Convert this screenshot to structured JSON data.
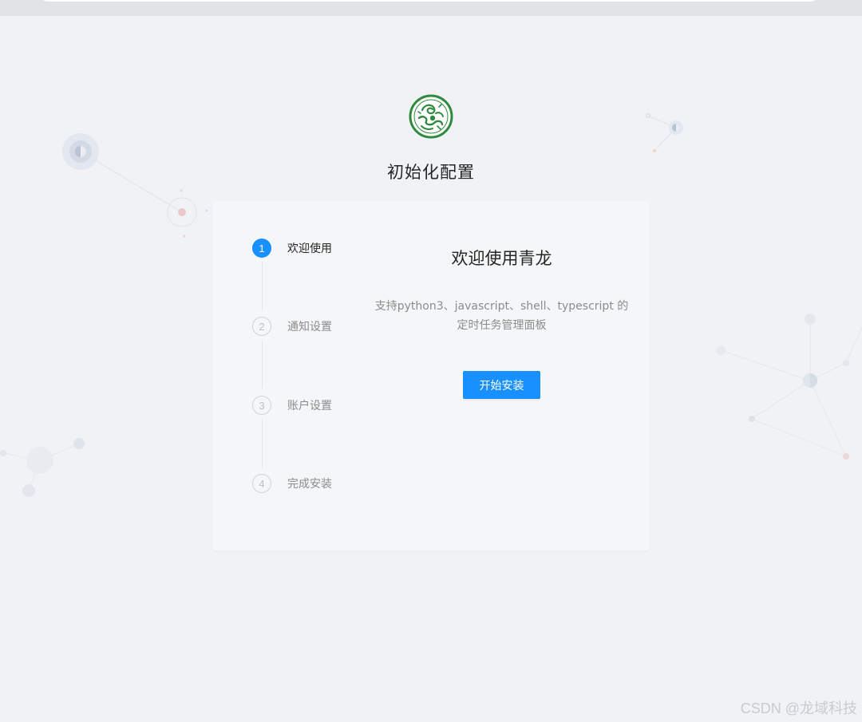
{
  "page": {
    "title": "初始化配置"
  },
  "steps": [
    {
      "number": "1",
      "label": "欢迎使用",
      "status": "active"
    },
    {
      "number": "2",
      "label": "通知设置",
      "status": "wait"
    },
    {
      "number": "3",
      "label": "账户设置",
      "status": "wait"
    },
    {
      "number": "4",
      "label": "完成安装",
      "status": "wait"
    }
  ],
  "welcome": {
    "heading": "欢迎使用青龙",
    "description_line1": "支持python3、javascript、shell、typescript 的",
    "description_line2": "定时任务管理面板",
    "start_button": "开始安装"
  },
  "watermark": "CSDN @龙域科技",
  "colors": {
    "primary": "#1890ff",
    "background": "#f0f2f5",
    "card": "#f5f6f8",
    "logo_green": "#2e8b3e"
  },
  "icons": {
    "logo": "qinglong-dragon-logo"
  }
}
